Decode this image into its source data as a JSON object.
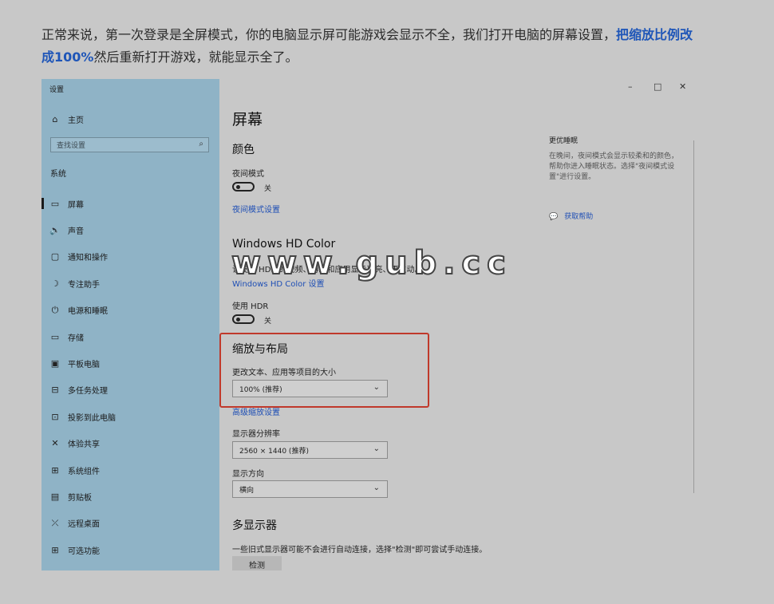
{
  "article": {
    "intro_text": "正常来说，第一次登录是全屏模式，你的电脑显示屏可能游戏会显示不全，我们打开电脑的屏幕设置，",
    "intro_highlight": "把缩放比例改成100%",
    "intro_tail": "然后重新打开游戏，就能显示全了。"
  },
  "window": {
    "title": "设置",
    "controls": {
      "minimize": "–",
      "maximize": "□",
      "close": "✕"
    }
  },
  "sidebar": {
    "home_label": "主页",
    "search_placeholder": "查找设置",
    "section_label": "系统",
    "items": [
      {
        "label": "屏幕",
        "icon": "monitor-icon",
        "glyph": "▭"
      },
      {
        "label": "声音",
        "icon": "speaker-icon",
        "glyph": "🔈"
      },
      {
        "label": "通知和操作",
        "icon": "notification-icon",
        "glyph": "▢"
      },
      {
        "label": "专注助手",
        "icon": "moon-icon",
        "glyph": "☽"
      },
      {
        "label": "电源和睡眠",
        "icon": "power-icon",
        "glyph": "⏻"
      },
      {
        "label": "存储",
        "icon": "storage-icon",
        "glyph": "▭"
      },
      {
        "label": "平板电脑",
        "icon": "tablet-icon",
        "glyph": "▣"
      },
      {
        "label": "多任务处理",
        "icon": "multitask-icon",
        "glyph": "⊟"
      },
      {
        "label": "投影到此电脑",
        "icon": "projector-icon",
        "glyph": "⊡"
      },
      {
        "label": "体验共享",
        "icon": "share-icon",
        "glyph": "✕"
      },
      {
        "label": "系统组件",
        "icon": "components-icon",
        "glyph": "⊞"
      },
      {
        "label": "剪贴板",
        "icon": "clipboard-icon",
        "glyph": "▤"
      },
      {
        "label": "远程桌面",
        "icon": "remote-desktop-icon",
        "glyph": "⤫"
      },
      {
        "label": "可选功能",
        "icon": "optional-features-icon",
        "glyph": "⊞"
      }
    ]
  },
  "main": {
    "page_title": "屏幕",
    "color_heading": "颜色",
    "night_mode_label": "夜间模式",
    "night_mode_state": "关",
    "night_mode_link": "夜间模式设置",
    "hdr_heading": "Windows HD Color",
    "hdr_desc": "让支持 HDR 的视频、游戏和应用显示更亮、更生动。",
    "hdr_link": "Windows HD Color 设置",
    "use_hdr_label": "使用 HDR",
    "use_hdr_state": "关",
    "scale_heading": "缩放与布局",
    "scale_label": "更改文本、应用等项目的大小",
    "scale_value": "100% (推荐)",
    "advanced_scale_link": "高级缩放设置",
    "resolution_label": "显示器分辨率",
    "resolution_value": "2560 × 1440 (推荐)",
    "orientation_label": "显示方向",
    "orientation_value": "横向",
    "multi_display_heading": "多显示器",
    "multi_display_desc": "一些旧式显示器可能不会进行自动连接，选择\"检测\"即可尝试手动连接。",
    "detect_button": "检测"
  },
  "right_panel": {
    "title": "更优睡眠",
    "text": "在晚间，夜间模式会显示较柔和的颜色，帮助你进入睡眠状态。选择\"夜间模式设置\"进行设置。",
    "help_link": "获取帮助"
  },
  "watermark": {
    "text": "www.gub.cc"
  }
}
